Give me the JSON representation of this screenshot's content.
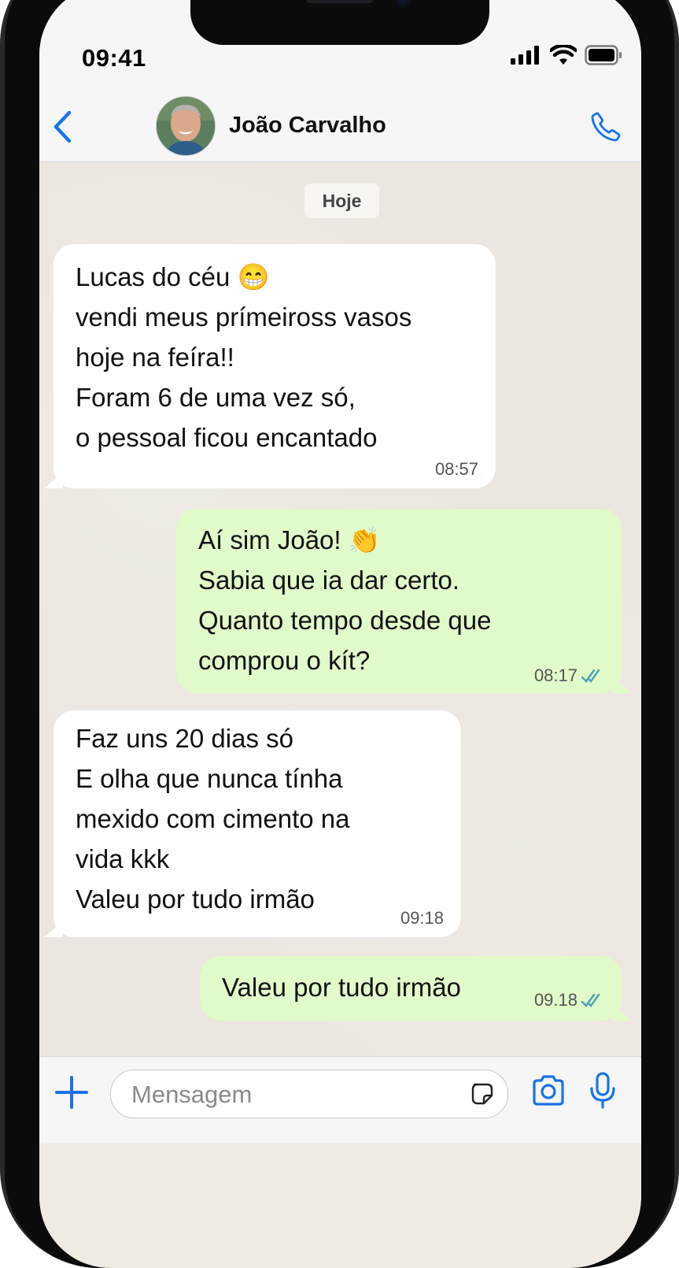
{
  "status_bar": {
    "time": "09:41"
  },
  "header": {
    "contact_name": "João Carvalho",
    "icons": [
      "back-chevron-icon",
      "avatar",
      "phone-icon"
    ]
  },
  "chat": {
    "date_label": "Hoje",
    "messages": [
      {
        "direction": "in",
        "text": "Lucas do céu 😁\nvendi meus prímeiross vasos\nhoje na feíra!!\nForam 6 de uma vez só,\no pessoal ficou encantado",
        "time": "08:57"
      },
      {
        "direction": "out",
        "text": "Aí sim João! 👏\nSabia que ia dar certo.\nQuanto tempo desde que\ncomprou o kít?",
        "time": "08:17",
        "status": "read"
      },
      {
        "direction": "in",
        "text": "Faz uns 20 dias só\nE olha que nunca tínha\nmexido com cimento na\nvida kkk\nValeu por tudo irmão",
        "time": "09:18"
      },
      {
        "direction": "out",
        "text": "Valeu por tudo irmão",
        "time": "09.18",
        "status": "read"
      }
    ]
  },
  "composer": {
    "placeholder": "Mensagem",
    "icons": [
      "plus-icon",
      "sticker-icon",
      "camera-icon",
      "microphone-icon"
    ]
  },
  "colors": {
    "accent": "#1a73e8",
    "incoming_bubble": "#ffffff",
    "outgoing_bubble": "#e0fac9",
    "chat_background": "#ebe6df",
    "read_ticks": "#4aa3b8"
  }
}
